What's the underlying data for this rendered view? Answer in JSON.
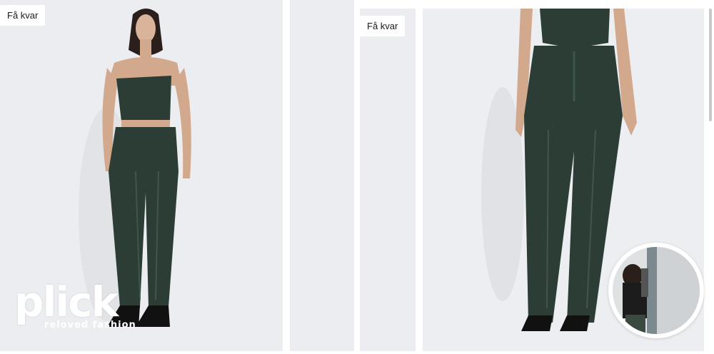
{
  "products": [
    {
      "badge": "Få kvar",
      "image": "model-full-body-green-leather-set"
    },
    {
      "image": "plain-grey-card"
    },
    {
      "badge": "Få kvar",
      "image": "model-leather-pants-closeup"
    }
  ],
  "logo": {
    "name": "plick",
    "tagline": "reloved fashion"
  },
  "video_thumbnail": {
    "icon": "play-video-thumbnail"
  },
  "colors": {
    "card_bg": "#ebedf0",
    "leather_green": "#2b3d34",
    "badge_bg": "#ffffff"
  }
}
